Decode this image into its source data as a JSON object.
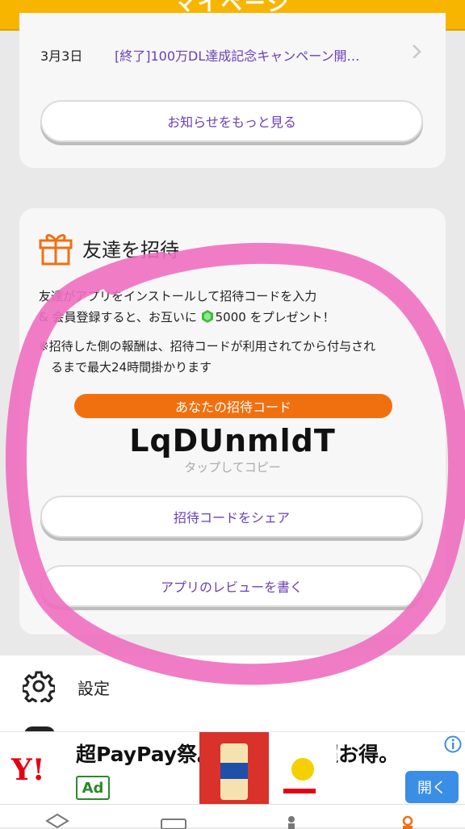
{
  "header": {
    "title": "マイページ"
  },
  "news": {
    "items": [
      {
        "date": "3月3日",
        "text": "[終了]100万DL達成記念キャンペーン開…"
      }
    ],
    "more_label": "お知らせをもっと見る"
  },
  "invite": {
    "title": "友達を招待",
    "description_line1": "友達がアプリをインストールして招待コードを入力",
    "description_line2_a": "& 会員登録すると、お互いに ",
    "description_line2_b": "5000 をプレゼント！",
    "note_line1": "※招待した側の報酬は、招待コードが利用されてから付与され",
    "note_line2": "　るまで最大24時間掛かります",
    "code_badge": "あなたの招待コード",
    "code": "LqDUnmldT",
    "copy_hint": "タップしてコピー",
    "share_label": "招待コードをシェア",
    "review_label": "アプリのレビューを書く"
  },
  "settings": {
    "label": "設定"
  },
  "ad": {
    "logo": "Y!",
    "headline": "超PayPay祭。人気商品も超お得。",
    "ad_tag": "Ad",
    "open_label": "開く"
  },
  "colors": {
    "header": "#f7b500",
    "accent_purple": "#6a3fb5",
    "badge_orange": "#f07010",
    "marker_pink": "#f06ec0"
  }
}
